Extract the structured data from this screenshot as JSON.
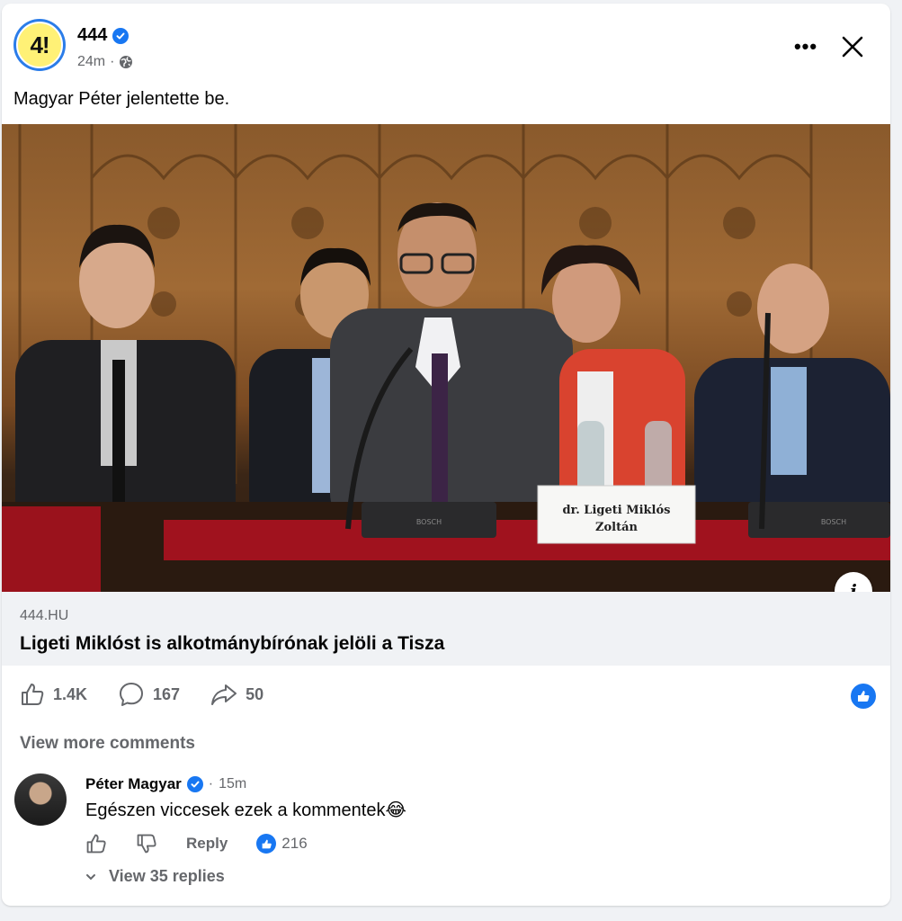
{
  "post": {
    "page_name": "444",
    "avatar_text": "4!",
    "time": "24m",
    "meta_separator": "·",
    "text": "Magyar Péter jelentette be.",
    "more_label": "•••"
  },
  "photo": {
    "nameplate_line1": "dr. Ligeti Miklós",
    "nameplate_line2": "Zoltán",
    "mic_brand": "BOSCH",
    "info_label": "i"
  },
  "link_preview": {
    "domain": "444.HU",
    "title": "Ligeti Miklóst is alkotmánybírónak jelöli a Tisza"
  },
  "actions": {
    "likes": "1.4K",
    "comments": "167",
    "shares": "50"
  },
  "comments": {
    "view_more": "View more comments",
    "items": [
      {
        "author": "Péter Magyar",
        "time": "15m",
        "text": "Egészen viccesek ezek a kommentek😂",
        "reply_label": "Reply",
        "reactions": "216",
        "view_replies": "View 35 replies"
      }
    ]
  },
  "colors": {
    "brand_blue": "#1877f2",
    "avatar_yellow": "#fff176",
    "secondary_text": "#65676b",
    "link_bg": "#f0f2f5"
  }
}
